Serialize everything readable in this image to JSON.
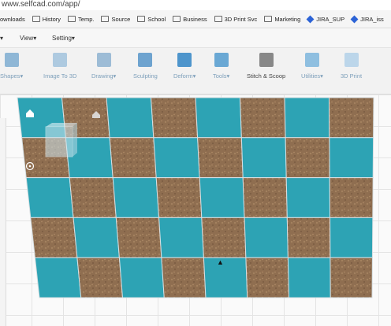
{
  "browser": {
    "url": "www.selfcad.com/app/"
  },
  "bookmarks": [
    {
      "label": "ownloads",
      "icon": "none"
    },
    {
      "label": "History",
      "icon": "folder-icon"
    },
    {
      "label": "Temp.",
      "icon": "folder-icon"
    },
    {
      "label": "Source",
      "icon": "folder-icon"
    },
    {
      "label": "School",
      "icon": "folder-icon"
    },
    {
      "label": "Business",
      "icon": "folder-icon"
    },
    {
      "label": "3D Print Svc",
      "icon": "folder-icon"
    },
    {
      "label": "Marketing",
      "icon": "folder-icon"
    },
    {
      "label": "JIRA_SUP",
      "icon": "jira-icon"
    },
    {
      "label": "JIRA_iss",
      "icon": "jira-icon"
    }
  ],
  "menu": {
    "view": "View",
    "setting": "Setting"
  },
  "toolbar": {
    "items": [
      {
        "label": "Shapes",
        "icon": "cube-icon",
        "color": "#8fb7d6",
        "dark": false
      },
      {
        "label": "Image To 3D",
        "icon": "image-3d-icon",
        "color": "#aecae0",
        "dark": false
      },
      {
        "label": "Drawing",
        "icon": "pencil-icon",
        "color": "#9dbcd6",
        "dark": false
      },
      {
        "label": "Sculpting",
        "icon": "sculpt-icon",
        "color": "#6ea3cf",
        "dark": false
      },
      {
        "label": "Deform",
        "icon": "deform-icon",
        "color": "#4e95cc",
        "dark": false
      },
      {
        "label": "Tools",
        "icon": "tools-icon",
        "color": "#6aa8d4",
        "dark": false
      },
      {
        "label": "Stitch & Scoop",
        "icon": "stitch-icon",
        "color": "#888888",
        "dark": true
      },
      {
        "label": "Utilities",
        "icon": "utilities-icon",
        "color": "#8fbfe0",
        "dark": false
      },
      {
        "label": "3D Print",
        "icon": "print-icon",
        "color": "#bcd6ea",
        "dark": false
      }
    ]
  },
  "board": {
    "rows": 5,
    "cols": 8,
    "tile_colors": {
      "teal": "#2da3b4",
      "wood": "#8f6e50"
    }
  }
}
